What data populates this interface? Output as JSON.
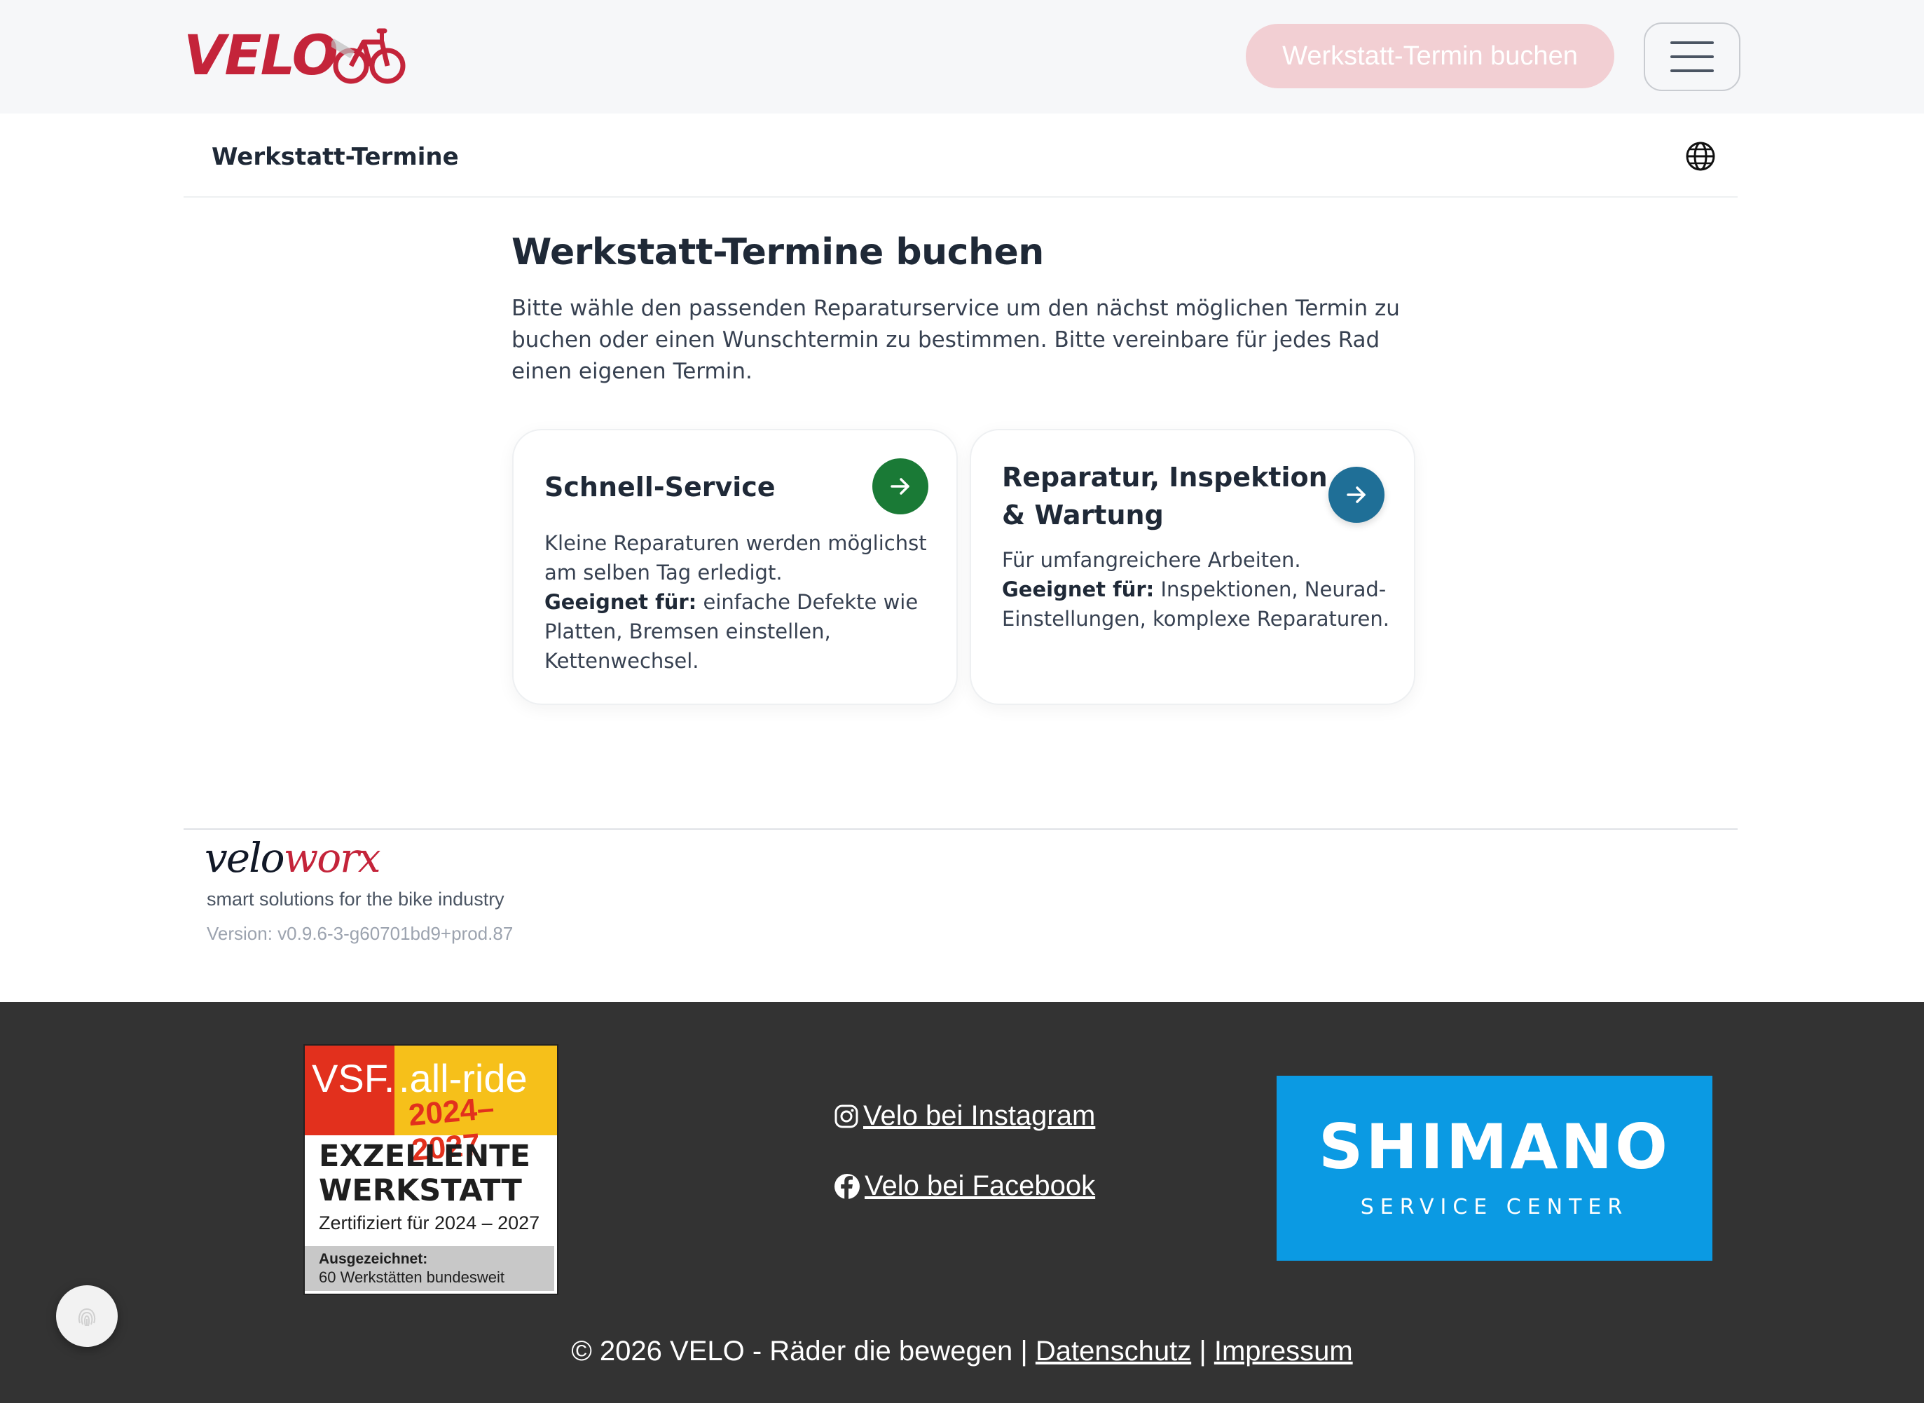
{
  "header": {
    "logo_text": "VELO",
    "book_button_label": "Werkstatt-Termin buchen",
    "menu_icon": "hamburger-menu-icon",
    "brand_color": "#c4243a"
  },
  "subheader": {
    "title": "Werkstatt-Termine",
    "language_icon": "globe-icon"
  },
  "main": {
    "title": "Werkstatt-Termine buchen",
    "intro": "Bitte wähle den passenden Reparaturservice um den nächst möglichen Termin zu buchen oder einen Wunschtermin zu bestimmen. Bitte vereinbare für jedes Rad einen eigenen Termin.",
    "cards": [
      {
        "title": "Schnell-Service",
        "description": "Kleine Reparaturen werden möglichst am selben Tag erledigt.",
        "suited_label": "Geeignet für:",
        "suited_text": " einfache Defekte wie Platten, Bremsen einstellen, Kettenwechsel.",
        "arrow_color": "#1a7a36"
      },
      {
        "title": "Reparatur, Inspektion & Wartung",
        "description": "Für umfangreichere Arbeiten.",
        "suited_label": "Geeignet für:",
        "suited_text": " Inspektionen, Neurad-Einstellungen, komplexe Reparaturen.",
        "arrow_color": "#1f6f97"
      }
    ]
  },
  "veloworx": {
    "logo_part1": "velo",
    "logo_part2": "worx",
    "tagline": "smart solutions for the bike industry",
    "version": "Version: v0.9.6-3-g60701bd9+prod.87"
  },
  "footer": {
    "vsf_badge": {
      "brand": "VSF.",
      "program": ".all-ride",
      "years": "2024–2027",
      "headline_line1": "EXZELLENTE",
      "headline_line2": "WERKSTATT",
      "certified": "Zertifiziert für 2024 – 2027",
      "awarded_label": "Ausgezeichnet:",
      "awarded_text": "60 Werkstätten bundesweit"
    },
    "instagram_label": "Velo bei Instagram",
    "facebook_label": "Velo bei Facebook",
    "shimano": {
      "name": "SHIMANO",
      "subtitle": "SERVICE CENTER"
    },
    "copyright": "© 2026 VELO - Räder die bewegen |",
    "privacy_link": "Datenschutz",
    "separator": "|",
    "imprint_link": "Impressum",
    "background": "#333333"
  },
  "floating_button_icon": "fingerprint-icon"
}
